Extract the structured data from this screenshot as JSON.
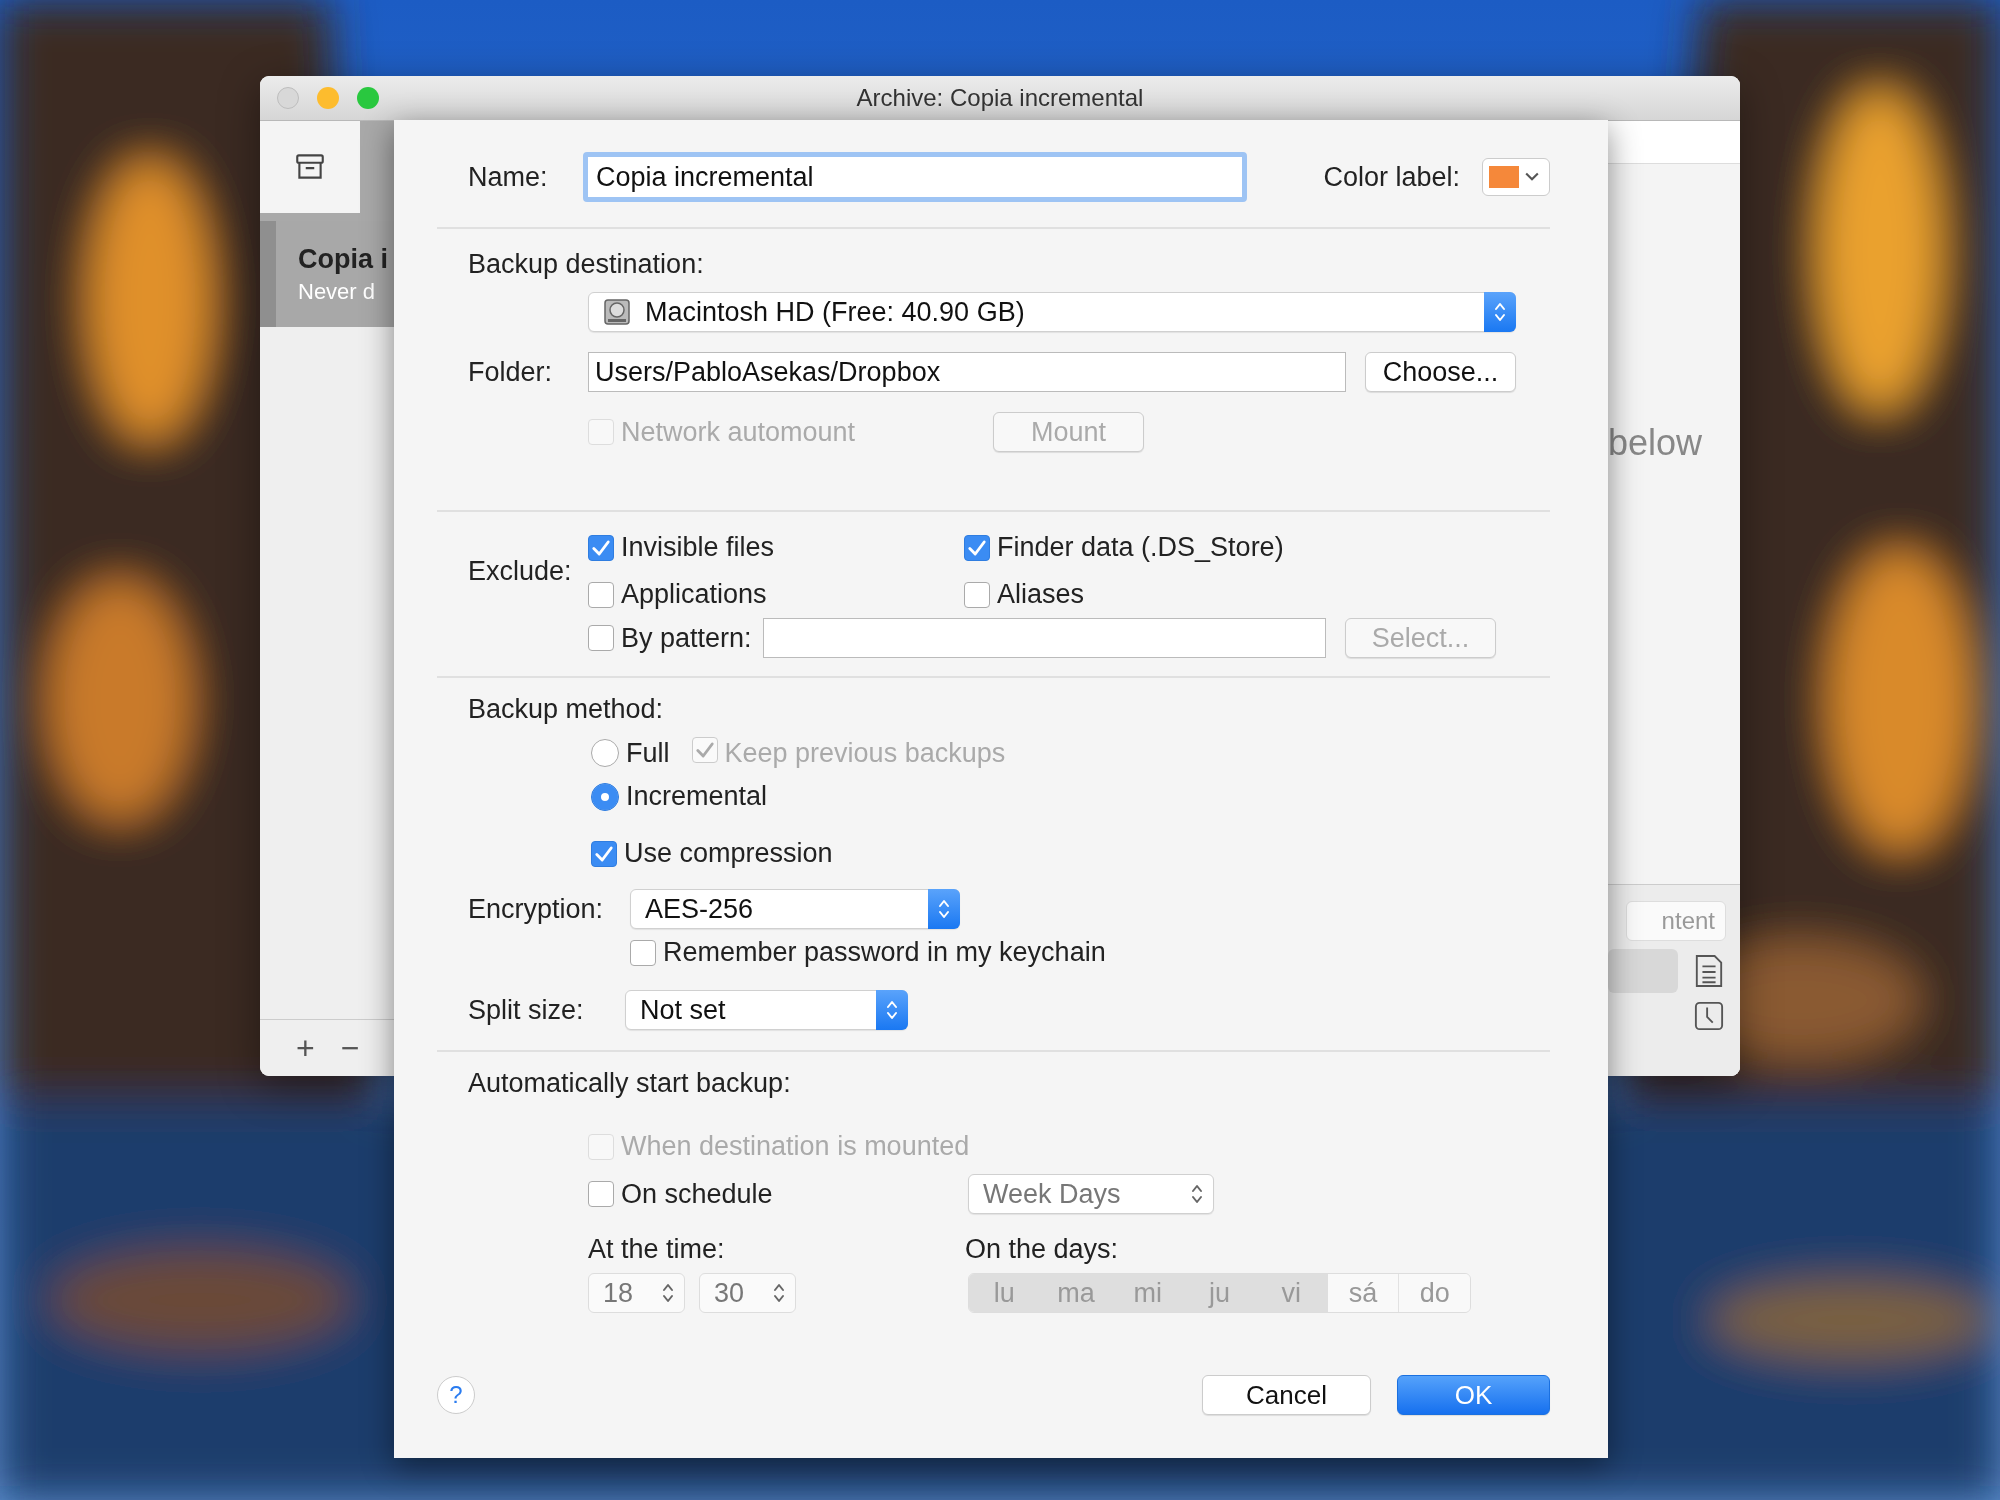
{
  "window": {
    "title": "Archive: Copia incremental"
  },
  "sidebar": {
    "item_title": "Copia i",
    "item_subtitle": "Never d",
    "add": "+",
    "remove": "−"
  },
  "content": {
    "hint": "below",
    "button": "ntent"
  },
  "sheet": {
    "name": {
      "label": "Name:",
      "value": "Copia incremental"
    },
    "color_label": {
      "label": "Color label:",
      "color": "#f5883a"
    },
    "destination": {
      "label": "Backup destination:",
      "value": "Macintosh HD (Free: 40.90 GB)"
    },
    "folder": {
      "label": "Folder:",
      "value": "Users/PabloAsekas/Dropbox",
      "button": "Choose..."
    },
    "network_automount": {
      "label": "Network automount",
      "checked": false,
      "disabled": true
    },
    "mount_button": {
      "label": "Mount",
      "disabled": true
    },
    "exclude": {
      "label": "Exclude:",
      "options": [
        {
          "label": "Invisible files",
          "checked": true
        },
        {
          "label": "Finder data (.DS_Store)",
          "checked": true
        },
        {
          "label": "Applications",
          "checked": false
        },
        {
          "label": "Aliases",
          "checked": false
        }
      ],
      "pattern": {
        "label": "By pattern:",
        "checked": false
      },
      "select_button": {
        "label": "Select...",
        "disabled": true
      }
    },
    "method": {
      "label": "Backup method:",
      "options": [
        {
          "label": "Full",
          "selected": false
        },
        {
          "label": "Incremental",
          "selected": true
        }
      ],
      "keep_previous": {
        "label": "Keep previous backups",
        "checked": true,
        "disabled": true
      },
      "compression": {
        "label": "Use compression",
        "checked": true
      }
    },
    "encryption": {
      "label": "Encryption:",
      "value": "AES-256",
      "remember": {
        "label": "Remember password in my keychain",
        "checked": false
      }
    },
    "split": {
      "label": "Split size:",
      "value": "Not set"
    },
    "auto": {
      "label": "Automatically start backup:",
      "when_mounted": {
        "label": "When destination is mounted",
        "checked": false,
        "disabled": true
      },
      "on_schedule": {
        "label": "On schedule",
        "checked": false
      },
      "frequency": "Week Days",
      "time_label": "At the time:",
      "hour": "18",
      "minute": "30",
      "days_label": "On the days:",
      "days": [
        {
          "label": "lu",
          "selected": true
        },
        {
          "label": "ma",
          "selected": true
        },
        {
          "label": "mi",
          "selected": true
        },
        {
          "label": "ju",
          "selected": true
        },
        {
          "label": "vi",
          "selected": true
        },
        {
          "label": "sá",
          "selected": false
        },
        {
          "label": "do",
          "selected": false
        }
      ]
    },
    "help": "?",
    "buttons": [
      {
        "label": "Cancel",
        "kind": "default"
      },
      {
        "label": "OK",
        "kind": "primary"
      }
    ]
  }
}
